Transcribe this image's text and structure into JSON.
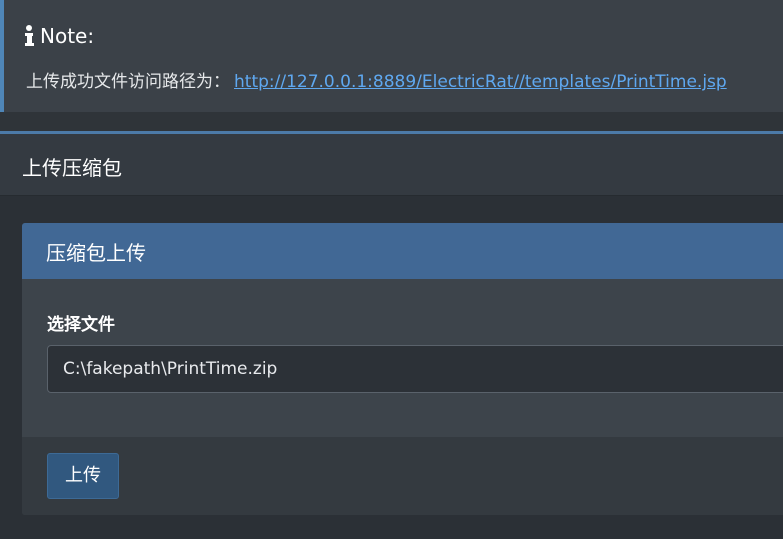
{
  "note": {
    "icon": "info-icon",
    "title": "Note:",
    "message": "上传成功文件访问路径为：",
    "link_text": "http://127.0.0.1:8889/ElectricRat//templates/PrintTime.jsp"
  },
  "card": {
    "title": "上传压缩包",
    "panel": {
      "title": "压缩包上传",
      "field_label": "选择文件",
      "file_value": "C:\\fakepath\\PrintTime.zip",
      "submit_label": "上传"
    }
  },
  "colors": {
    "accent": "#416895",
    "link": "#5fa8f0",
    "note_border": "#4f86b8",
    "button": "#31587f"
  }
}
